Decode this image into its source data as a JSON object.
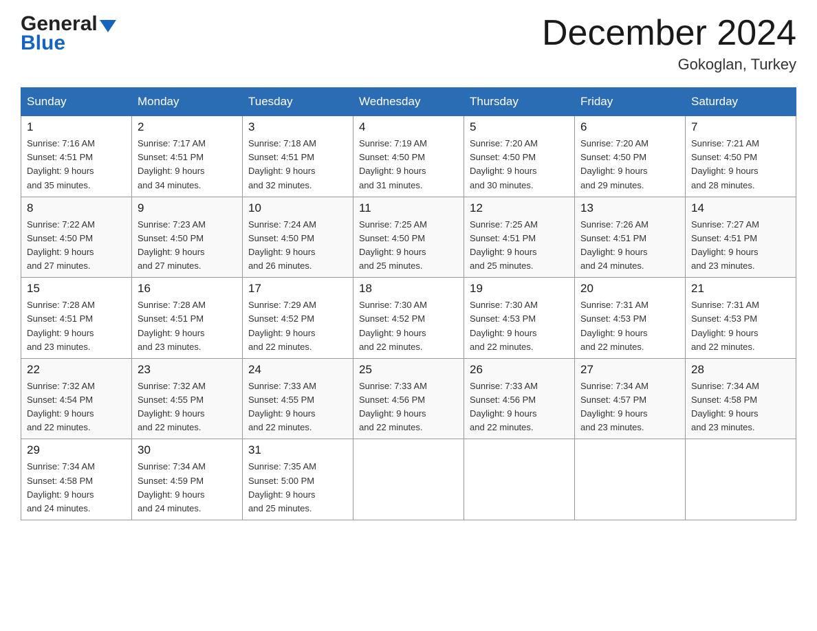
{
  "header": {
    "logo_general": "General",
    "logo_blue": "Blue",
    "month_title": "December 2024",
    "location": "Gokoglan, Turkey"
  },
  "columns": [
    "Sunday",
    "Monday",
    "Tuesday",
    "Wednesday",
    "Thursday",
    "Friday",
    "Saturday"
  ],
  "weeks": [
    [
      {
        "day": "1",
        "info": "Sunrise: 7:16 AM\nSunset: 4:51 PM\nDaylight: 9 hours\nand 35 minutes."
      },
      {
        "day": "2",
        "info": "Sunrise: 7:17 AM\nSunset: 4:51 PM\nDaylight: 9 hours\nand 34 minutes."
      },
      {
        "day": "3",
        "info": "Sunrise: 7:18 AM\nSunset: 4:51 PM\nDaylight: 9 hours\nand 32 minutes."
      },
      {
        "day": "4",
        "info": "Sunrise: 7:19 AM\nSunset: 4:50 PM\nDaylight: 9 hours\nand 31 minutes."
      },
      {
        "day": "5",
        "info": "Sunrise: 7:20 AM\nSunset: 4:50 PM\nDaylight: 9 hours\nand 30 minutes."
      },
      {
        "day": "6",
        "info": "Sunrise: 7:20 AM\nSunset: 4:50 PM\nDaylight: 9 hours\nand 29 minutes."
      },
      {
        "day": "7",
        "info": "Sunrise: 7:21 AM\nSunset: 4:50 PM\nDaylight: 9 hours\nand 28 minutes."
      }
    ],
    [
      {
        "day": "8",
        "info": "Sunrise: 7:22 AM\nSunset: 4:50 PM\nDaylight: 9 hours\nand 27 minutes."
      },
      {
        "day": "9",
        "info": "Sunrise: 7:23 AM\nSunset: 4:50 PM\nDaylight: 9 hours\nand 27 minutes."
      },
      {
        "day": "10",
        "info": "Sunrise: 7:24 AM\nSunset: 4:50 PM\nDaylight: 9 hours\nand 26 minutes."
      },
      {
        "day": "11",
        "info": "Sunrise: 7:25 AM\nSunset: 4:50 PM\nDaylight: 9 hours\nand 25 minutes."
      },
      {
        "day": "12",
        "info": "Sunrise: 7:25 AM\nSunset: 4:51 PM\nDaylight: 9 hours\nand 25 minutes."
      },
      {
        "day": "13",
        "info": "Sunrise: 7:26 AM\nSunset: 4:51 PM\nDaylight: 9 hours\nand 24 minutes."
      },
      {
        "day": "14",
        "info": "Sunrise: 7:27 AM\nSunset: 4:51 PM\nDaylight: 9 hours\nand 23 minutes."
      }
    ],
    [
      {
        "day": "15",
        "info": "Sunrise: 7:28 AM\nSunset: 4:51 PM\nDaylight: 9 hours\nand 23 minutes."
      },
      {
        "day": "16",
        "info": "Sunrise: 7:28 AM\nSunset: 4:51 PM\nDaylight: 9 hours\nand 23 minutes."
      },
      {
        "day": "17",
        "info": "Sunrise: 7:29 AM\nSunset: 4:52 PM\nDaylight: 9 hours\nand 22 minutes."
      },
      {
        "day": "18",
        "info": "Sunrise: 7:30 AM\nSunset: 4:52 PM\nDaylight: 9 hours\nand 22 minutes."
      },
      {
        "day": "19",
        "info": "Sunrise: 7:30 AM\nSunset: 4:53 PM\nDaylight: 9 hours\nand 22 minutes."
      },
      {
        "day": "20",
        "info": "Sunrise: 7:31 AM\nSunset: 4:53 PM\nDaylight: 9 hours\nand 22 minutes."
      },
      {
        "day": "21",
        "info": "Sunrise: 7:31 AM\nSunset: 4:53 PM\nDaylight: 9 hours\nand 22 minutes."
      }
    ],
    [
      {
        "day": "22",
        "info": "Sunrise: 7:32 AM\nSunset: 4:54 PM\nDaylight: 9 hours\nand 22 minutes."
      },
      {
        "day": "23",
        "info": "Sunrise: 7:32 AM\nSunset: 4:55 PM\nDaylight: 9 hours\nand 22 minutes."
      },
      {
        "day": "24",
        "info": "Sunrise: 7:33 AM\nSunset: 4:55 PM\nDaylight: 9 hours\nand 22 minutes."
      },
      {
        "day": "25",
        "info": "Sunrise: 7:33 AM\nSunset: 4:56 PM\nDaylight: 9 hours\nand 22 minutes."
      },
      {
        "day": "26",
        "info": "Sunrise: 7:33 AM\nSunset: 4:56 PM\nDaylight: 9 hours\nand 22 minutes."
      },
      {
        "day": "27",
        "info": "Sunrise: 7:34 AM\nSunset: 4:57 PM\nDaylight: 9 hours\nand 23 minutes."
      },
      {
        "day": "28",
        "info": "Sunrise: 7:34 AM\nSunset: 4:58 PM\nDaylight: 9 hours\nand 23 minutes."
      }
    ],
    [
      {
        "day": "29",
        "info": "Sunrise: 7:34 AM\nSunset: 4:58 PM\nDaylight: 9 hours\nand 24 minutes."
      },
      {
        "day": "30",
        "info": "Sunrise: 7:34 AM\nSunset: 4:59 PM\nDaylight: 9 hours\nand 24 minutes."
      },
      {
        "day": "31",
        "info": "Sunrise: 7:35 AM\nSunset: 5:00 PM\nDaylight: 9 hours\nand 25 minutes."
      },
      {
        "day": "",
        "info": ""
      },
      {
        "day": "",
        "info": ""
      },
      {
        "day": "",
        "info": ""
      },
      {
        "day": "",
        "info": ""
      }
    ]
  ]
}
